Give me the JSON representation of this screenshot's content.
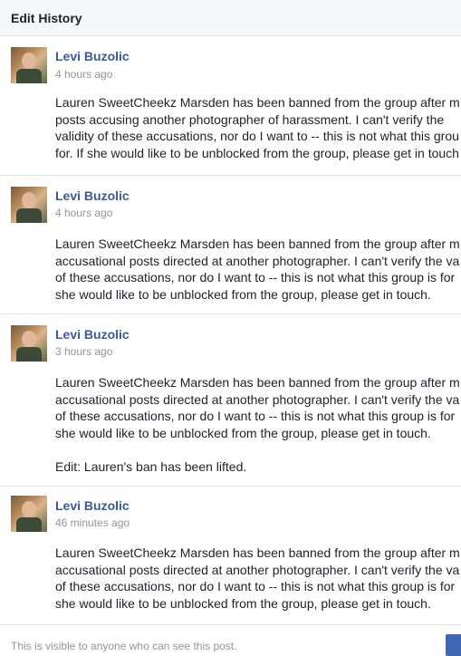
{
  "dialog": {
    "title": "Edit History"
  },
  "entries": [
    {
      "author": "Levi Buzolic",
      "time": "4 hours ago",
      "text": "Lauren SweetCheekz Marsden has been banned from the group after m\nposts accusing another photographer of harassment. I can't verify the\nvalidity of these accusations, nor do I want to -- this is not what this grou\nfor. If she would like to be unblocked from the group, please get in touch"
    },
    {
      "author": "Levi Buzolic",
      "time": "4 hours ago",
      "text": "Lauren SweetCheekz Marsden has been banned from the group after m\naccusational posts directed at another photographer. I can't verify the va\nof these accusations, nor do I want to -- this is not what this group is for\nshe would like to be unblocked from the group, please get in touch."
    },
    {
      "author": "Levi Buzolic",
      "time": "3 hours ago",
      "text": "Lauren SweetCheekz Marsden has been banned from the group after m\naccusational posts directed at another photographer. I can't verify the va\nof these accusations, nor do I want to -- this is not what this group is for\nshe would like to be unblocked from the group, please get in touch.\n\nEdit: Lauren's ban has been lifted."
    },
    {
      "author": "Levi Buzolic",
      "time": "46 minutes ago",
      "text": "Lauren SweetCheekz Marsden has been banned from the group after m\naccusational posts directed at another photographer. I can't verify the va\nof these accusations, nor do I want to -- this is not what this group is for\nshe would like to be unblocked from the group, please get in touch."
    }
  ],
  "footer": {
    "visibility": "This is visible to anyone who can see this post."
  },
  "colors": {
    "author": "#3b5998",
    "time": "#90949c",
    "button": "#4267b2"
  }
}
